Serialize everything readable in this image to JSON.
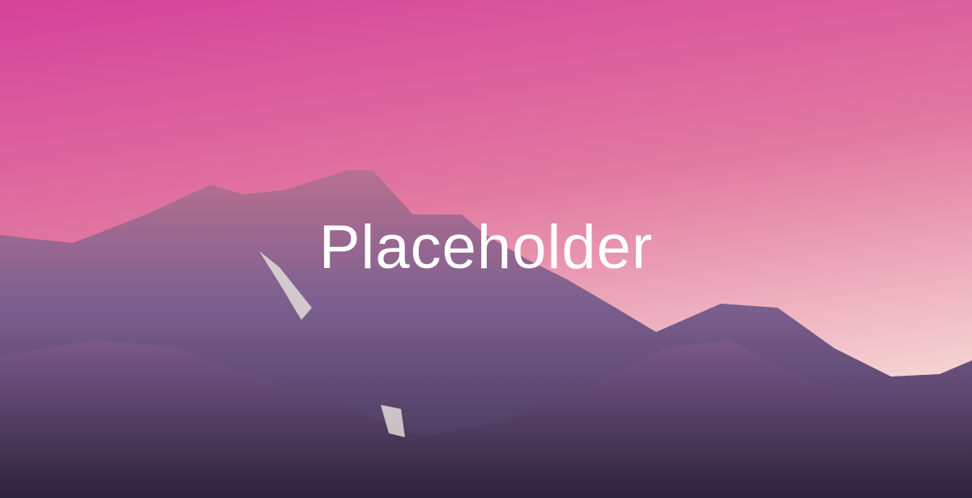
{
  "hero": {
    "caption": "Placeholder",
    "colors": {
      "sky_top": "#d4429a",
      "sky_bottom": "#f5d3d8",
      "mountain": "#6e4f8a",
      "mountain_dark": "#2e2440"
    }
  }
}
